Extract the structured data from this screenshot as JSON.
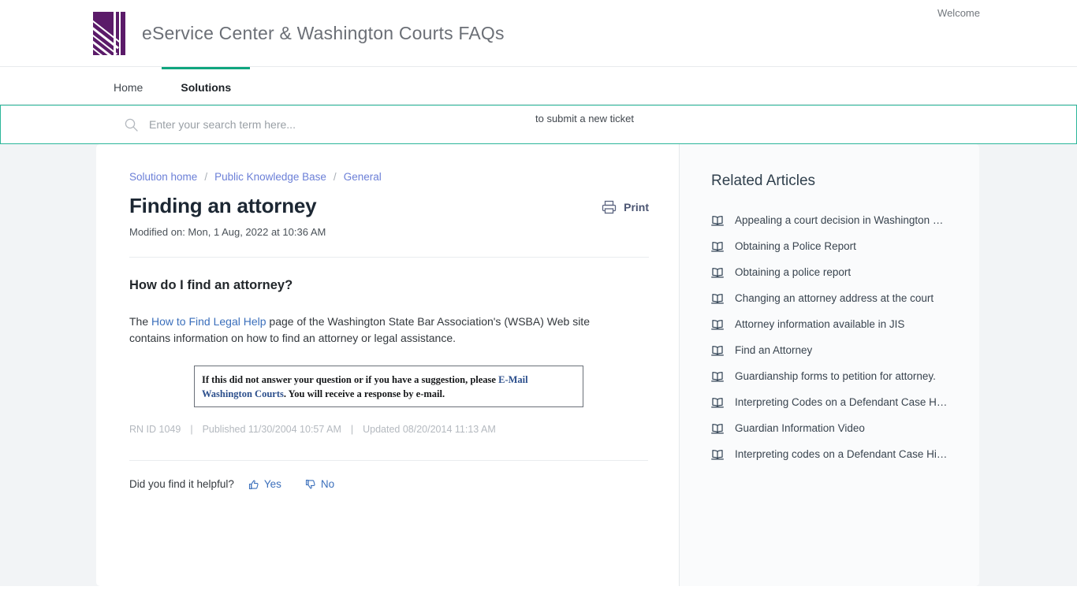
{
  "header": {
    "brand_title": "eService Center & Washington Courts FAQs",
    "welcome": "Welcome",
    "logo_color": "#5b1b69"
  },
  "nav": {
    "tabs": [
      {
        "label": "Home",
        "active": false
      },
      {
        "label": "Solutions",
        "active": true
      }
    ],
    "accent_color": "#0fa67f"
  },
  "search": {
    "placeholder": "Enter your search term here...",
    "value": "",
    "new_ticket_text": "to submit a new ticket",
    "border_color": "#2bb69a"
  },
  "breadcrumb": {
    "items": [
      "Solution home",
      "Public Knowledge Base",
      "General"
    ],
    "separator": "/"
  },
  "article": {
    "title": "Finding an attorney",
    "modified_on": "Modified on: Mon, 1 Aug, 2022 at 10:36 AM",
    "print_label": "Print",
    "heading": "How do I find an attorney?",
    "body_before_link": "The ",
    "body_link": "How to Find Legal Help",
    "body_after_link": " page of the Washington State Bar Association's (WSBA) Web site contains information on how to find an attorney or legal assistance.",
    "callout_before_link": "If this did not answer your question or if you have a suggestion, please ",
    "callout_link": "E-Mail Washington Courts",
    "callout_after_link": ".  You will receive a response by e-mail.",
    "meta": {
      "rn_id": "RN ID 1049",
      "published": "Published 11/30/2004 10:57 AM",
      "updated": "Updated 08/20/2014 11:13 AM",
      "separator": "|"
    },
    "feedback": {
      "question": "Did you find it helpful?",
      "yes_label": "Yes",
      "no_label": "No"
    }
  },
  "related": {
    "title": "Related Articles",
    "items": [
      {
        "label": "Appealing a court decision in Washington St…"
      },
      {
        "label": "Obtaining a Police Report"
      },
      {
        "label": "Obtaining a police report"
      },
      {
        "label": "Changing an attorney address at the court"
      },
      {
        "label": "Attorney information available in JIS"
      },
      {
        "label": "Find an Attorney"
      },
      {
        "label": "Guardianship forms to petition for attorney."
      },
      {
        "label": "Interpreting Codes on a Defendant Case His…"
      },
      {
        "label": "Guardian Information Video"
      },
      {
        "label": "Interpreting codes on a Defendant Case Hist…"
      }
    ]
  }
}
